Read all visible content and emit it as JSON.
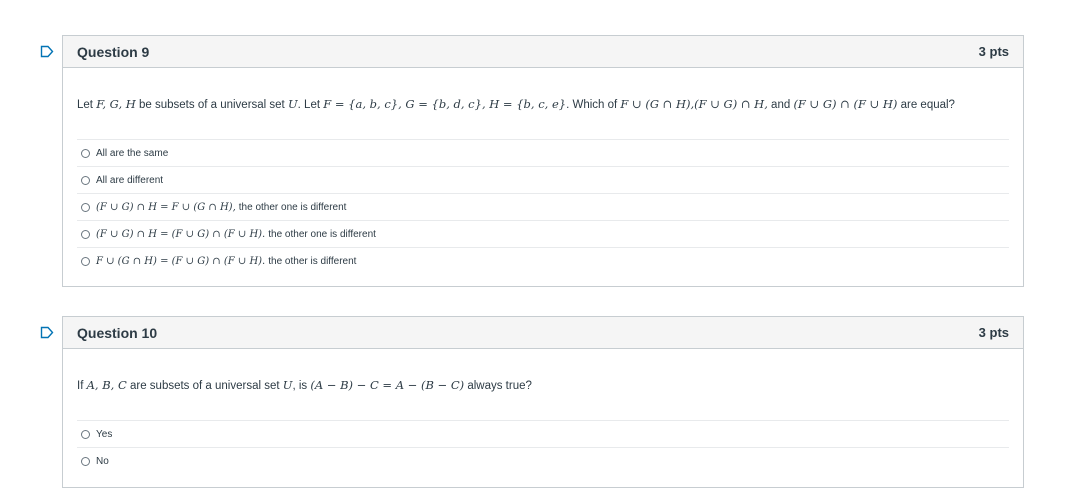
{
  "colors": {
    "accent": "#0374b5",
    "header_bg": "#f5f5f5",
    "border": "#c7cdd1",
    "text": "#2d3b45"
  },
  "questions": [
    {
      "title": "Question 9",
      "points": "3 pts",
      "flag_icon": "bookmark-flag-icon",
      "text": {
        "p1": "Let ",
        "m1": "F, G, H",
        "p2": " be subsets of a universal set ",
        "m2": "U",
        "p3": ". Let ",
        "m3": "F = {a, b, c}, G = {b, d, c}, H = {b, c, e}",
        "p4": ". Which of ",
        "m4": "F ∪ (G ∩ H),(F ∪ G) ∩ H,",
        "p5": " and ",
        "m5": "(F ∪ G) ∩ (F ∪ H)",
        "p6": " are equal?"
      },
      "answers": [
        {
          "math": "",
          "label": "All are the same"
        },
        {
          "math": "",
          "label": "All are different"
        },
        {
          "math": "(F ∪ G) ∩ H = F ∪ (G ∩ H),",
          "label": "the other one is different"
        },
        {
          "math": "(F ∪ G) ∩ H = (F ∪ G) ∩ (F ∪ H).",
          "label": "the other one is different"
        },
        {
          "math": "F ∪ (G ∩ H) = (F ∪ G) ∩ (F ∪ H).",
          "label": "the other is different"
        }
      ]
    },
    {
      "title": "Question 10",
      "points": "3 pts",
      "flag_icon": "bookmark-flag-icon",
      "text": {
        "p1": "If ",
        "m1": "A, B, C",
        "p2": " are subsets of a universal set ",
        "m2": "U",
        "p3": ", is ",
        "m3": "(A − B) − C = A − (B − C)",
        "p4": " always true?"
      },
      "answers": [
        {
          "math": "",
          "label": "Yes"
        },
        {
          "math": "",
          "label": "No"
        }
      ]
    }
  ]
}
